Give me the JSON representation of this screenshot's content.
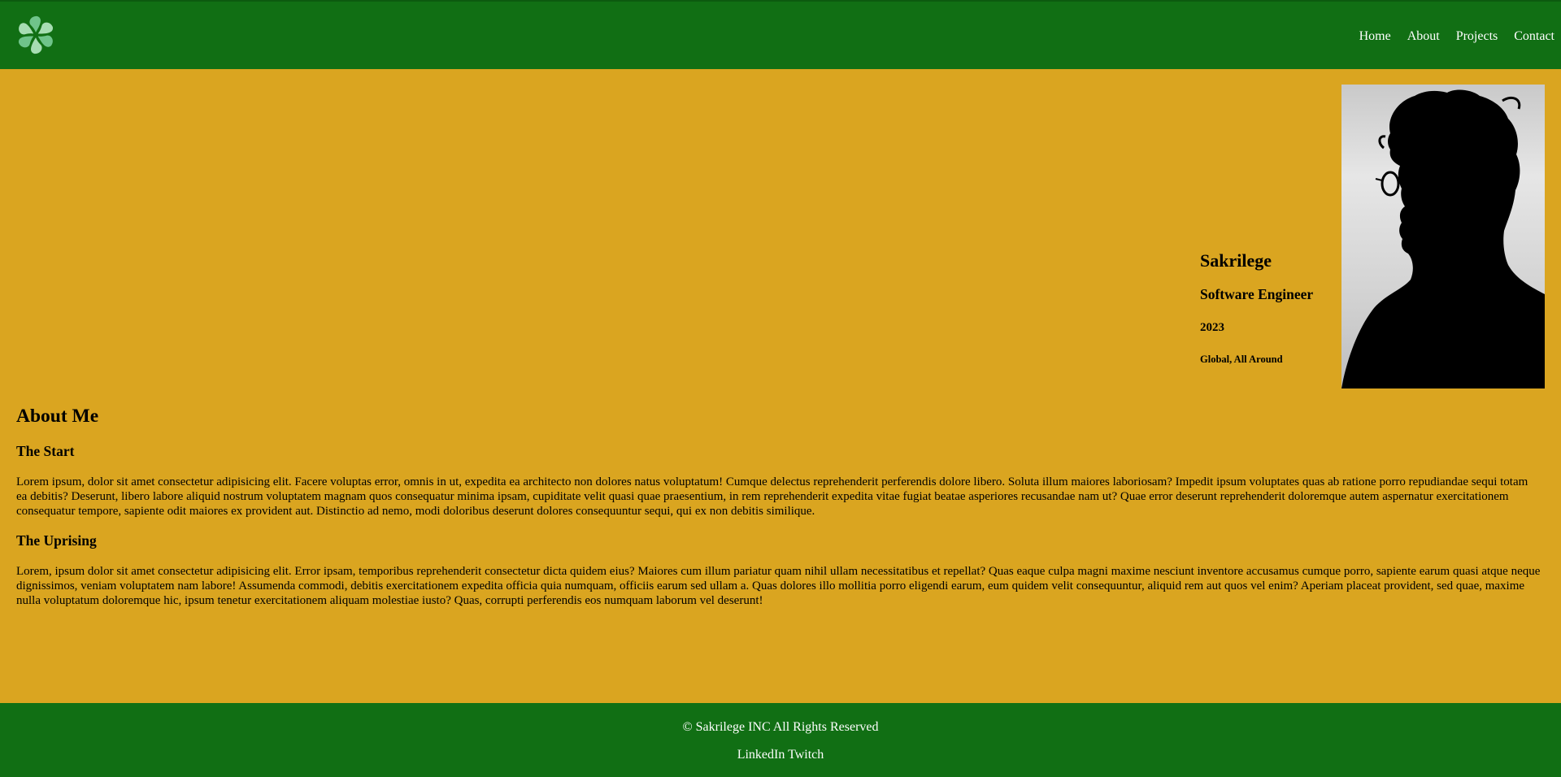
{
  "header": {
    "logo_icon": "pinwheel-logo-icon",
    "nav": {
      "home": "Home",
      "about": "About",
      "projects": "Projects",
      "contact": "Contact"
    }
  },
  "hero": {
    "name": "Sakrilege",
    "role": "Software Engineer",
    "year": "2023",
    "location": "Global, All Around",
    "portrait_icon": "silhouette-portrait-image"
  },
  "about": {
    "heading": "About Me",
    "sections": [
      {
        "title": "The Start",
        "body": "Lorem ipsum, dolor sit amet consectetur adipisicing elit. Facere voluptas error, omnis in ut, expedita ea architecto non dolores natus voluptatum! Cumque delectus reprehenderit perferendis dolore libero. Soluta illum maiores laboriosam? Impedit ipsum voluptates quas ab ratione porro repudiandae sequi totam ea debitis? Deserunt, libero labore aliquid nostrum voluptatem magnam quos consequatur minima ipsam, cupiditate velit quasi quae praesentium, in rem reprehenderit expedita vitae fugiat beatae asperiores recusandae nam ut? Quae error deserunt reprehenderit doloremque autem aspernatur exercitationem consequatur tempore, sapiente odit maiores ex provident aut. Distinctio ad nemo, modi doloribus deserunt dolores consequuntur sequi, qui ex non debitis similique."
      },
      {
        "title": "The Uprising",
        "body": "Lorem, ipsum dolor sit amet consectetur adipisicing elit. Error ipsam, temporibus reprehenderit consectetur dicta quidem eius? Maiores cum illum pariatur quam nihil ullam necessitatibus et repellat? Quas eaque culpa magni maxime nesciunt inventore accusamus cumque porro, sapiente earum quasi atque neque dignissimos, veniam voluptatem nam labore! Assumenda commodi, debitis exercitationem expedita officia quia numquam, officiis earum sed ullam a. Quas dolores illo mollitia porro eligendi earum, eum quidem velit consequuntur, aliquid rem aut quos vel enim? Aperiam placeat provident, sed quae, maxime nulla voluptatum doloremque hic, ipsum tenetur exercitationem aliquam molestiae iusto? Quas, corrupti perferendis eos numquam laborum vel deserunt!"
      }
    ]
  },
  "footer": {
    "copyright": "© Sakrilege INC All Rights Reserved",
    "links": {
      "linkedin": "LinkedIn",
      "twitch": "Twitch"
    }
  },
  "colors": {
    "header_footer_bg": "#116F14",
    "page_bg": "#DAA520",
    "nav_text": "#FFFFFF"
  }
}
